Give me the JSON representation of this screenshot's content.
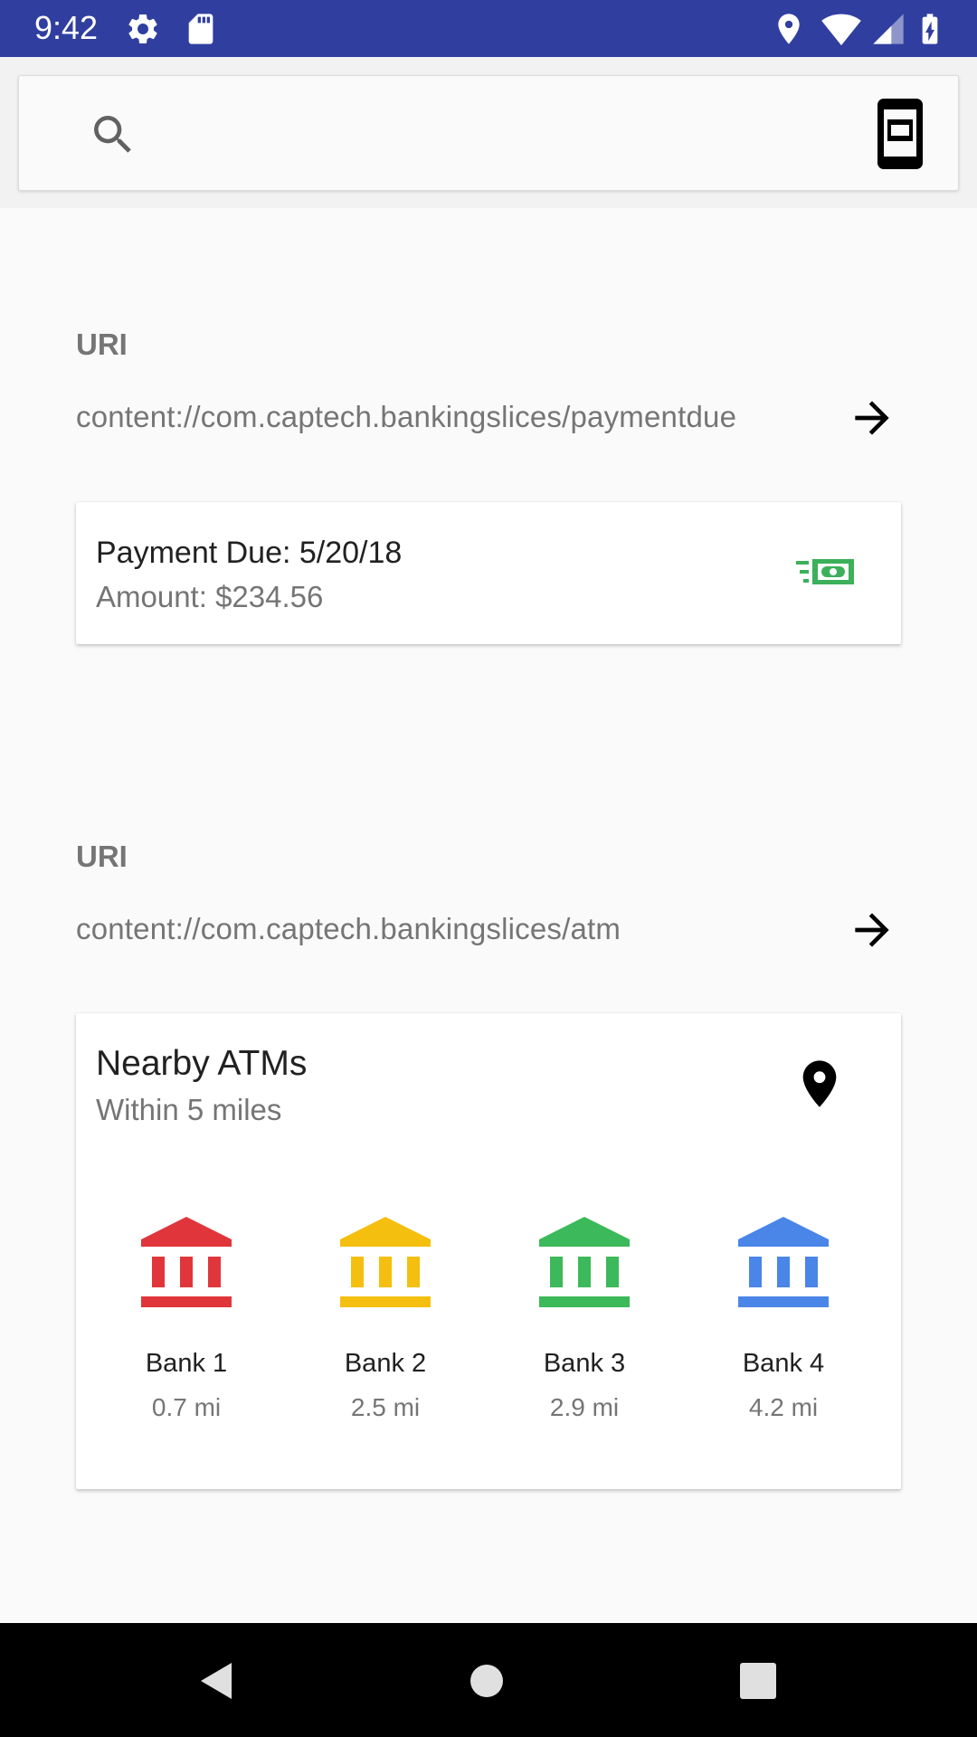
{
  "status_bar": {
    "time": "9:42",
    "background": "#303f9f",
    "icons": [
      "settings-icon",
      "sd-card-icon",
      "location-icon",
      "wifi-icon",
      "cell-signal-icon",
      "battery-charging-icon"
    ]
  },
  "search": {
    "value": "",
    "placeholder": "",
    "icons": [
      "search-icon",
      "phone-slice-icon"
    ]
  },
  "payment_section": {
    "uri_label": "URI",
    "uri": "content://com.captech.bankingslices/paymentdue",
    "card": {
      "title": "Payment Due: 5/20/18",
      "subtitle": "Amount: $234.56",
      "icon": "money-icon",
      "icon_color": "#3cb05a"
    }
  },
  "atm_section": {
    "uri_label": "URI",
    "uri": "content://com.captech.bankingslices/atm",
    "card": {
      "title": "Nearby ATMs",
      "subtitle": "Within 5 miles",
      "icon": "location-pin-icon",
      "banks": [
        {
          "name": "Bank 1",
          "distance": "0.7 mi",
          "color": "#e0363b"
        },
        {
          "name": "Bank 2",
          "distance": "2.5 mi",
          "color": "#f5bf0f"
        },
        {
          "name": "Bank 3",
          "distance": "2.9 mi",
          "color": "#3cb95a"
        },
        {
          "name": "Bank 4",
          "distance": "4.2 mi",
          "color": "#4a85e8"
        }
      ]
    }
  },
  "nav_bar": {
    "buttons": [
      "back-button",
      "home-button",
      "recents-button"
    ]
  }
}
